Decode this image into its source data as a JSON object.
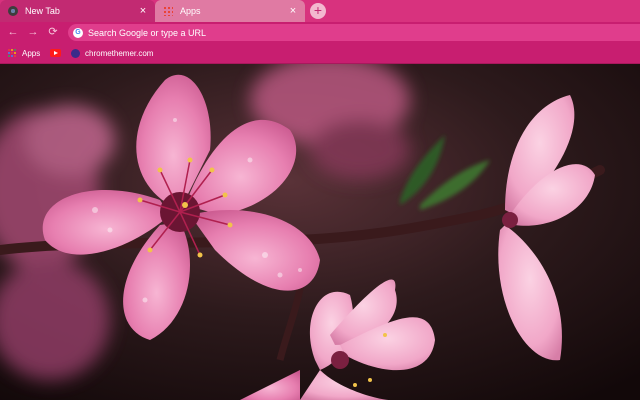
{
  "tabs": [
    {
      "label": "New Tab",
      "close": "×"
    },
    {
      "label": "Apps",
      "close": "×"
    }
  ],
  "new_tab_symbol": "+",
  "toolbar": {
    "back": "←",
    "forward": "→",
    "reload": "⟳"
  },
  "omnibox": {
    "placeholder": "Search Google or type a URL",
    "google_letter": "G"
  },
  "bookmarks": [
    {
      "label": "Apps",
      "icon": "apps-grid-icon"
    },
    {
      "label": "",
      "icon": "youtube-icon"
    },
    {
      "label": "chromethemer.com",
      "icon": "chromethemer-icon"
    }
  ],
  "colors": {
    "tabstrip": "#d8327e",
    "active_tab": "#c22a72",
    "inactive_tab": "#e07aa3",
    "toolbar": "#c81e70",
    "omnibox": "#e03d8c"
  },
  "background": {
    "subject": "cherry-blossom-photo"
  }
}
